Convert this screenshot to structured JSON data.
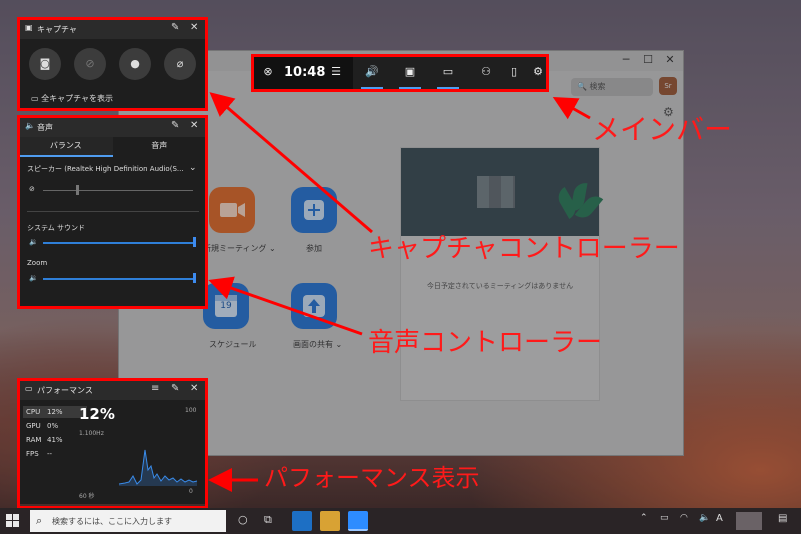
{
  "capture_panel": {
    "title": "キャプチャ",
    "show_all": "全キャプチャを表示"
  },
  "audio_panel": {
    "title": "音声",
    "tab_balance": "バランス",
    "tab_voice": "音声",
    "speaker": "スピーカー (Realtek High Definition Audio(S...",
    "system_sound": "システム サウンド",
    "app": "Zoom"
  },
  "perf_panel": {
    "title": "パフォーマンス",
    "cpu_label": "CPU",
    "cpu_val": "12%",
    "gpu_label": "GPU",
    "gpu_val": "0%",
    "ram_label": "RAM",
    "ram_val": "41%",
    "fps_label": "FPS",
    "fps_val": "--",
    "big_value": "12%",
    "freq": "1.100Hz",
    "max": "100",
    "zero": "0",
    "time_window": "60 秒"
  },
  "main_bar": {
    "time": "10:48"
  },
  "zoom": {
    "search_placeholder": "検索",
    "avatar": "Sr",
    "new_meeting": "新規ミーティング ⌄",
    "join": "参加",
    "schedule": "スケジュール",
    "share_screen": "画面の共有 ⌄",
    "calendar_day": "19",
    "no_meetings": "今日予定されているミーティングはありません"
  },
  "taskbar": {
    "search_placeholder": "検索するには、ここに入力します",
    "ime": "A"
  },
  "annotations": {
    "main_bar": "メインバー",
    "capture": "キャプチャコントローラー",
    "audio": "音声コントローラー",
    "performance": "パフォーマンス表示"
  },
  "colors": {
    "highlight": "#ff0000",
    "accent": "#4f9cf0",
    "zoom_blue": "#2d8cff",
    "zoom_orange": "#f26d21"
  }
}
